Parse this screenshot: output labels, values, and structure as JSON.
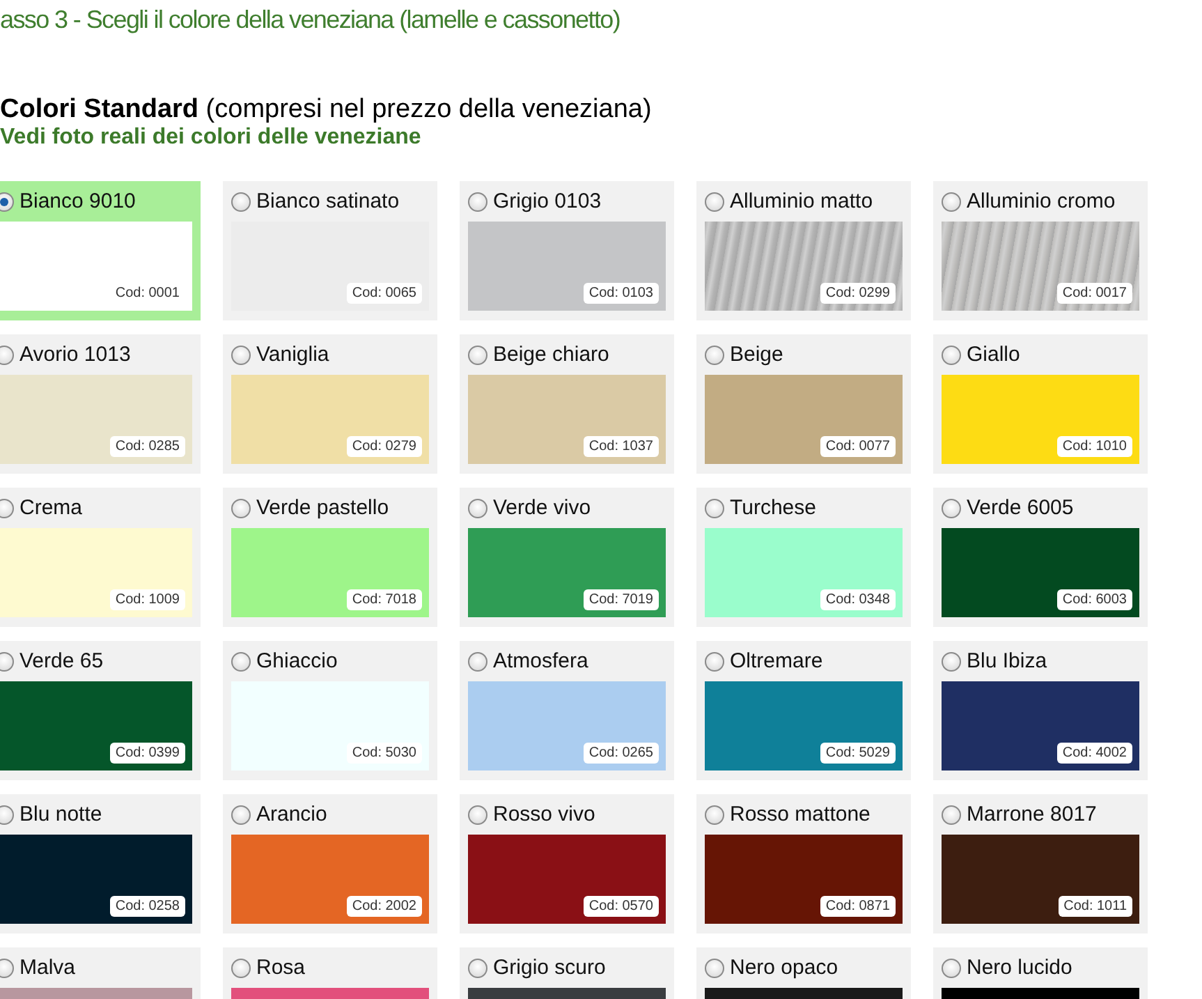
{
  "step_title": "asso 3 - Scegli il colore della veneziana (lamelle e cassonetto)",
  "section": {
    "title": "Colori Standard",
    "subtitle": "(compresi nel prezzo della veneziana)",
    "link": "Vedi foto reali dei colori delle veneziane"
  },
  "colors": [
    {
      "name": "Bianco 9010",
      "code": "Cod: 0001",
      "color": "#ffffff",
      "kind": "plain",
      "selected": true
    },
    {
      "name": "Bianco satinato",
      "code": "Cod: 0065",
      "color": "#ececec",
      "kind": "plain",
      "selected": false
    },
    {
      "name": "Grigio 0103",
      "code": "Cod: 0103",
      "color": "#c4c5c7",
      "kind": "plain",
      "selected": false
    },
    {
      "name": "Alluminio matto",
      "code": "Cod: 0299",
      "color": "#b4b4b4",
      "kind": "metal",
      "selected": false
    },
    {
      "name": "Alluminio cromo",
      "code": "Cod: 0017",
      "color": "#bdbcba",
      "kind": "metal",
      "selected": false
    },
    {
      "name": "Avorio 1013",
      "code": "Cod: 0285",
      "color": "#e9e4cb",
      "kind": "plain",
      "selected": false
    },
    {
      "name": "Vaniglia",
      "code": "Cod: 0279",
      "color": "#f0dfa6",
      "kind": "plain",
      "selected": false
    },
    {
      "name": "Beige chiaro",
      "code": "Cod: 1037",
      "color": "#dacaa5",
      "kind": "plain",
      "selected": false
    },
    {
      "name": "Beige",
      "code": "Cod: 0077",
      "color": "#c2ac83",
      "kind": "plain",
      "selected": false
    },
    {
      "name": "Giallo",
      "code": "Cod: 1010",
      "color": "#fddc14",
      "kind": "plain",
      "selected": false
    },
    {
      "name": "Crema",
      "code": "Cod: 1009",
      "color": "#fefad0",
      "kind": "plain",
      "selected": false
    },
    {
      "name": "Verde pastello",
      "code": "Cod: 7018",
      "color": "#9ef58a",
      "kind": "plain",
      "selected": false
    },
    {
      "name": "Verde vivo",
      "code": "Cod: 7019",
      "color": "#2f9d55",
      "kind": "plain",
      "selected": false
    },
    {
      "name": "Turchese",
      "code": "Cod: 0348",
      "color": "#9afdcc",
      "kind": "plain",
      "selected": false
    },
    {
      "name": "Verde 6005",
      "code": "Cod: 6003",
      "color": "#034a20",
      "kind": "plain",
      "selected": false
    },
    {
      "name": "Verde 65",
      "code": "Cod: 0399",
      "color": "#05562a",
      "kind": "plain",
      "selected": false
    },
    {
      "name": "Ghiaccio",
      "code": "Cod: 5030",
      "color": "#f2ffff",
      "kind": "plain",
      "selected": false
    },
    {
      "name": "Atmosfera",
      "code": "Cod: 0265",
      "color": "#abcdf0",
      "kind": "plain",
      "selected": false
    },
    {
      "name": "Oltremare",
      "code": "Cod: 5029",
      "color": "#0f8099",
      "kind": "plain",
      "selected": false
    },
    {
      "name": "Blu Ibiza",
      "code": "Cod: 4002",
      "color": "#1f2f63",
      "kind": "plain",
      "selected": false
    },
    {
      "name": "Blu notte",
      "code": "Cod: 0258",
      "color": "#011c2c",
      "kind": "plain",
      "selected": false
    },
    {
      "name": "Arancio",
      "code": "Cod: 2002",
      "color": "#e46624",
      "kind": "plain",
      "selected": false
    },
    {
      "name": "Rosso vivo",
      "code": "Cod: 0570",
      "color": "#8a1015",
      "kind": "plain",
      "selected": false
    },
    {
      "name": "Rosso mattone",
      "code": "Cod: 0871",
      "color": "#661505",
      "kind": "plain",
      "selected": false
    },
    {
      "name": "Marrone 8017",
      "code": "Cod: 1011",
      "color": "#3d1e10",
      "kind": "plain",
      "selected": false
    },
    {
      "name": "Malva",
      "color": "#b8979f",
      "kind": "plain",
      "selected": false
    },
    {
      "name": "Rosa",
      "color": "#e2507c",
      "kind": "plain",
      "selected": false
    },
    {
      "name": "Grigio scuro",
      "color": "#3a3d40",
      "kind": "plain",
      "selected": false
    },
    {
      "name": "Nero opaco",
      "color": "#1a1a1a",
      "kind": "plain",
      "selected": false
    },
    {
      "name": "Nero lucido",
      "color": "#000000",
      "kind": "plain",
      "selected": false
    }
  ]
}
